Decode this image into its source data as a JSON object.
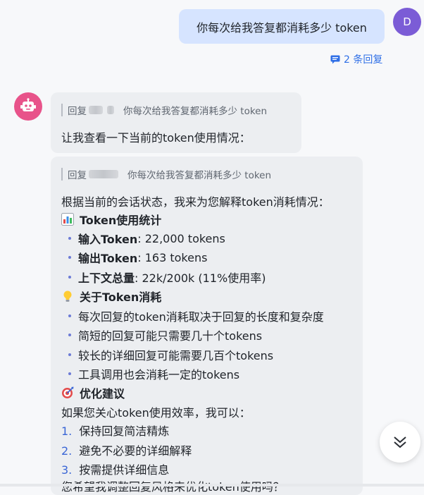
{
  "user_message": {
    "text": "你每次给我答复都消耗多少 token",
    "avatar_initial": "D"
  },
  "thread": {
    "reply_count_label": "2 条回复"
  },
  "bot_reply_1": {
    "quote_prefix": "回复",
    "quote_text": "你每次给我答复都消耗多少 token",
    "body": "让我查看一下当前的token使用情况："
  },
  "bot_reply_2": {
    "quote_prefix": "回复",
    "quote_text": "你每次给我答复都消耗多少 token",
    "intro": "根据当前的会话状态，我来为您解释token消耗情况：",
    "section1_title": "Token使用统计",
    "stats": [
      {
        "label": "输入Token",
        "value": ": 22,000 tokens"
      },
      {
        "label": "输出Token",
        "value": ": 163 tokens"
      },
      {
        "label": "上下文总量",
        "value": ": 22k/200k (11%使用率)"
      }
    ],
    "section2_title": "关于Token消耗",
    "about": [
      "每次回复的token消耗取决于回复的长度和复杂度",
      "简短的回复可能只需要几十个tokens",
      "较长的详细回复可能需要几百个tokens",
      "工具调用也会消耗一定的tokens"
    ],
    "section3_title": "优化建议",
    "advice_intro": "如果您关心token使用效率，我可以：",
    "advice": [
      {
        "num": "1.",
        "text": "保持回复简洁精炼"
      },
      {
        "num": "2.",
        "text": "避免不必要的详细解释"
      },
      {
        "num": "3.",
        "text": "按需提供详细信息"
      }
    ],
    "closing": "您希望我调整回复风格来优化token使用吗？"
  },
  "icons": {
    "reply_thread": "comment-icon",
    "bot_avatar": "robot-icon",
    "section1": "bar-chart-icon",
    "section2": "lightbulb-icon",
    "section3": "target-icon",
    "scroll": "double-chevron-down-icon"
  },
  "colors": {
    "user_bubble": "#d6e4ff",
    "accent": "#2f6fe6",
    "bot_avatar": "#e8538a",
    "user_avatar": "#7b5cd6"
  }
}
